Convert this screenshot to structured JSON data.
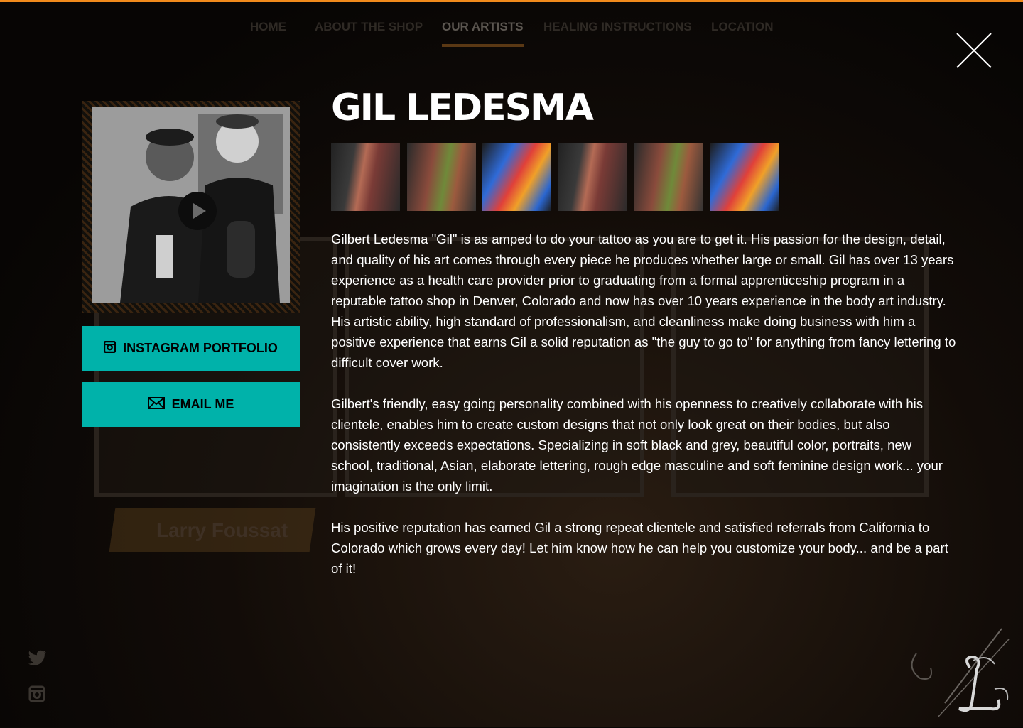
{
  "colors": {
    "accent": "#00b2aa",
    "topbar": "#f08a1c",
    "background": "#0a0806"
  },
  "nav": {
    "items": [
      {
        "label": "HOME"
      },
      {
        "label": "ABOUT THE SHOP"
      },
      {
        "label": "OUR ARTISTS",
        "active": true
      },
      {
        "label": "HEALING INSTRUCTIONS"
      },
      {
        "label": "LOCATION"
      }
    ]
  },
  "close": {
    "icon": "close-icon"
  },
  "background": {
    "artist_name": "Larry Foussat"
  },
  "artist": {
    "name": "GIL LEDESMA",
    "portfolio_thumbs": [
      {
        "icon": "tattoo-photo"
      },
      {
        "icon": "tattoo-photo"
      },
      {
        "icon": "tattoo-photo"
      },
      {
        "icon": "tattoo-photo"
      },
      {
        "icon": "tattoo-photo"
      },
      {
        "icon": "tattoo-photo"
      }
    ],
    "bio": [
      "Gilbert Ledesma \"Gil\" is as amped to do your tattoo as you are to get it. His passion for the design, detail, and quality of his art comes through every piece he produces whether large or small. Gil has over 13 years experience as a health care provider prior to graduating from a formal apprenticeship program in a reputable tattoo shop in Denver, Colorado and now has over 10 years experience in the body art industry. His artistic ability, high standard of professionalism, and cleanliness make doing business with him a positive experience that earns Gil a solid reputation as \"the guy to go to\" for anything from fancy lettering to difficult cover work.",
      "Gilbert's friendly, easy going personality combined with his openness to creatively collaborate with his clientele, enables him to create custom designs that not only look great on their bodies, but also consistently exceeds expectations. Specializing in soft black and grey, beautiful color, portraits, new school, traditional, Asian, elaborate lettering, rough edge masculine and soft feminine design work... your imagination is the only limit.",
      "His positive reputation has earned Gil a strong repeat clientele and satisfied referrals from California to Colorado which grows every day! Let him know how he can help you customize your body... and be a part of it!"
    ]
  },
  "buttons": {
    "instagram": {
      "label": "INSTAGRAM PORTFOLIO",
      "icon": "instagram-icon"
    },
    "email": {
      "label": "EMAIL ME",
      "icon": "mail-icon"
    }
  },
  "social": {
    "twitter_icon": "twitter-icon",
    "instagram_icon": "instagram-icon"
  },
  "logo": {
    "icon": "shop-logo-L"
  }
}
